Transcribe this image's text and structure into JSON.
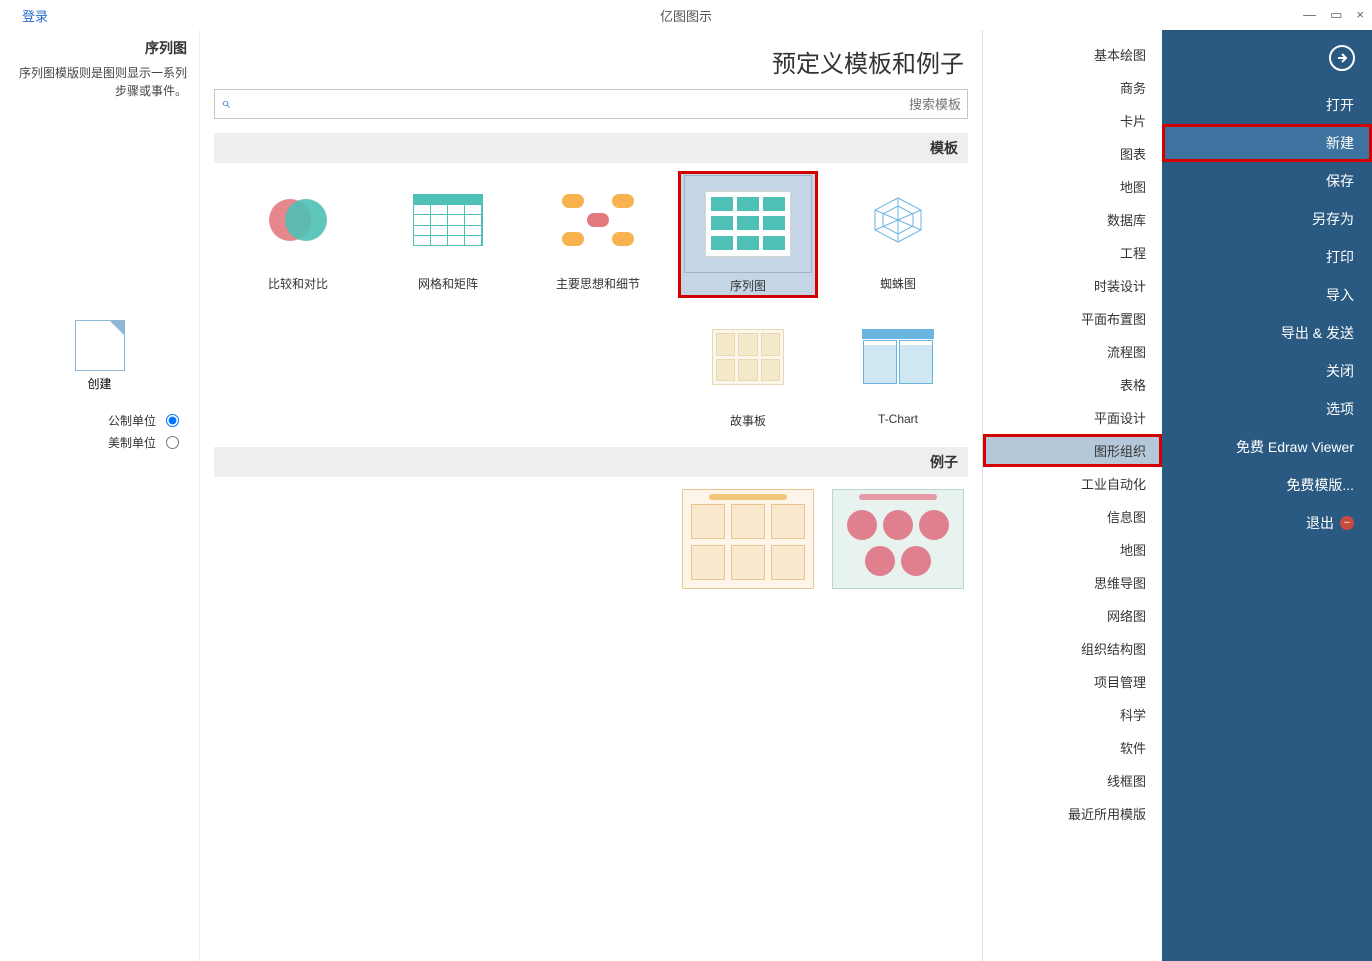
{
  "window": {
    "title": "亿图图示",
    "login": "登录",
    "close": "×",
    "restore": "▭",
    "min": "—"
  },
  "nav": {
    "items": [
      "打开",
      "新建",
      "保存",
      "另存为",
      "打印",
      "导入",
      "导出 & 发送",
      "关闭",
      "选项",
      "免费 Edraw Viewer",
      "免费模版..."
    ],
    "exit": "退出"
  },
  "categories": [
    "基本绘图",
    "商务",
    "卡片",
    "图表",
    "地图",
    "数据库",
    "工程",
    "时装设计",
    "平面布置图",
    "流程图",
    "表格",
    "平面设计",
    "图形组织",
    "工业自动化",
    "信息图",
    "地图",
    "思维导图",
    "网络图",
    "组织结构图",
    "项目管理",
    "科学",
    "软件",
    "线框图",
    "最近所用模版"
  ],
  "page_title": "预定义模板和例子",
  "search_placeholder": "搜索模板",
  "sections": {
    "templates": "模板",
    "examples": "例子"
  },
  "templates": [
    {
      "key": "venn",
      "label": "比较和对比"
    },
    {
      "key": "grid",
      "label": "网格和矩阵"
    },
    {
      "key": "mind",
      "label": "主要思想和细节"
    },
    {
      "key": "seq",
      "label": "序列图"
    },
    {
      "key": "spider",
      "label": "蜘蛛图"
    },
    {
      "key": "story",
      "label": "故事板"
    },
    {
      "key": "tchart",
      "label": "T-Chart"
    }
  ],
  "preview": {
    "heading": "序列图",
    "desc": "序列图模版则是图则显示一系列步骤或事件。",
    "create": "创建",
    "unit_metric": "公制单位",
    "unit_us": "美制单位"
  }
}
